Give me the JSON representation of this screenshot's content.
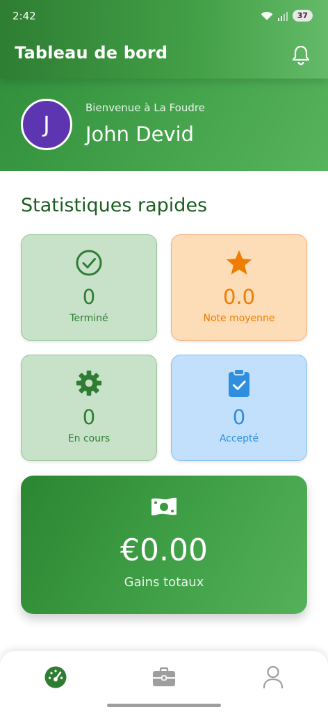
{
  "status_bar": {
    "time": "2:42",
    "battery": "37"
  },
  "header": {
    "title": "Tableau de bord",
    "bell_icon": "bell-icon"
  },
  "profile": {
    "avatar_initial": "J",
    "welcome": "Bienvenue à La Foudre",
    "name": "John Devid"
  },
  "stats": {
    "title": "Statistiques rapides",
    "cards": [
      {
        "icon": "check-circle-icon",
        "value": "0",
        "label": "Terminé",
        "color": "#2e7d32"
      },
      {
        "icon": "star-icon",
        "value": "0.0",
        "label": "Note moyenne",
        "color": "#ef7d00"
      },
      {
        "icon": "gear-icon",
        "value": "0",
        "label": "En cours",
        "color": "#2e7d32"
      },
      {
        "icon": "clipboard-check-icon",
        "value": "0",
        "label": "Accepté",
        "color": "#2f8fde"
      }
    ]
  },
  "earnings": {
    "icon": "money-icon",
    "value": "€0.00",
    "label": "Gains totaux"
  },
  "bottom_nav": {
    "items": [
      {
        "icon": "dashboard-icon",
        "active": true
      },
      {
        "icon": "briefcase-icon",
        "active": false
      },
      {
        "icon": "person-icon",
        "active": false
      }
    ]
  },
  "colors": {
    "primary_green": "#2e7d32",
    "accent_green": "#43a047",
    "orange": "#ef7d00",
    "blue": "#2f8fde",
    "avatar": "#5e35b1"
  }
}
